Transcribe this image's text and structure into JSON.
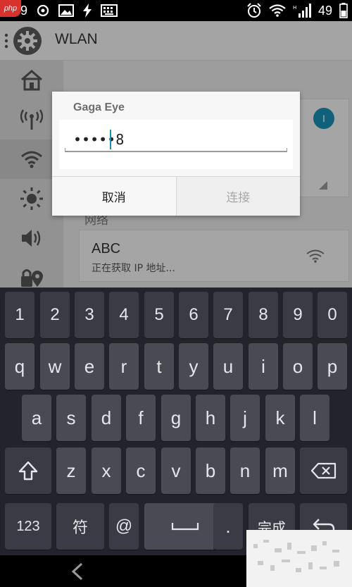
{
  "status_bar": {
    "time": "0:49",
    "battery": "49"
  },
  "app_bar": {
    "title": "WLAN"
  },
  "side_rail": {
    "items": [
      "home-icon",
      "antenna-icon",
      "wifi-icon",
      "brightness-icon",
      "volume-icon",
      "lock-location-icon"
    ]
  },
  "networks": [
    {
      "name": "ABC",
      "status": "正在获取 IP 地址..."
    }
  ],
  "section_label": "网络",
  "dialog": {
    "title": "Gaga Eye",
    "password_display": "•••••8",
    "cancel_label": "取消",
    "connect_label": "连接"
  },
  "keyboard": {
    "row_numbers": [
      "1",
      "2",
      "3",
      "4",
      "5",
      "6",
      "7",
      "8",
      "9",
      "0"
    ],
    "row_1": [
      "q",
      "w",
      "e",
      "r",
      "t",
      "y",
      "u",
      "i",
      "o",
      "p"
    ],
    "row_2": [
      "a",
      "s",
      "d",
      "f",
      "g",
      "h",
      "j",
      "k",
      "l"
    ],
    "row_3": [
      "z",
      "x",
      "c",
      "v",
      "b",
      "n",
      "m"
    ],
    "symbols_label": "123",
    "symbol_char_label": "符",
    "at_label": "@",
    "period_label": ".",
    "done_label": "完成"
  },
  "badge": {
    "text": "php"
  },
  "colors": {
    "accent": "#1a8fb5",
    "keyboard_bg": "#23232b",
    "key_bg": "#4a4a55"
  }
}
